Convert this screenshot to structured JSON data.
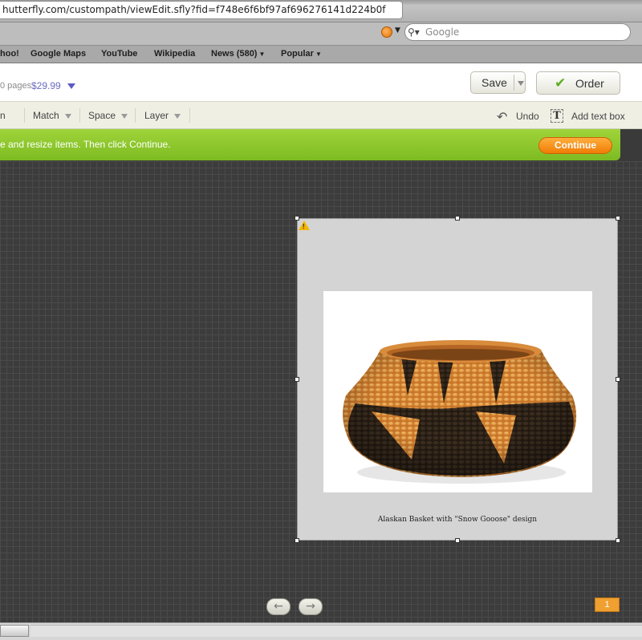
{
  "browser": {
    "url": "hutterfly.com/custompath/viewEdit.sfly?fid=f748e6f6bf97af696276141d224b0f",
    "search_placeholder": "Google",
    "bookmarks": [
      {
        "label": "hoo!",
        "has_menu": false
      },
      {
        "label": "Google Maps",
        "has_menu": false
      },
      {
        "label": "YouTube",
        "has_menu": false
      },
      {
        "label": "Wikipedia",
        "has_menu": false
      },
      {
        "label": "News (580)",
        "has_menu": true
      },
      {
        "label": "Popular",
        "has_menu": true
      }
    ]
  },
  "header": {
    "pages_text": "0 pages",
    "price": "$29.99",
    "save_label": "Save",
    "order_label": "Order"
  },
  "toolbar": {
    "items": [
      "n",
      "Match",
      "Space",
      "Layer"
    ],
    "undo_label": "Undo",
    "add_text_label": "Add text box"
  },
  "instruction": {
    "text": "e and resize items. Then click Continue.",
    "continue_label": "Continue"
  },
  "canvas": {
    "caption": "Alaskan Basket with \"Snow Gooose\" design",
    "warning_mark": "!",
    "page_number": "1",
    "prev_arrow": "←",
    "next_arrow": "→"
  },
  "colors": {
    "accent_green": "#8cc630",
    "continue_orange": "#f28a10",
    "price_blue": "#6a6ac0",
    "page_badge": "#f0a030"
  }
}
